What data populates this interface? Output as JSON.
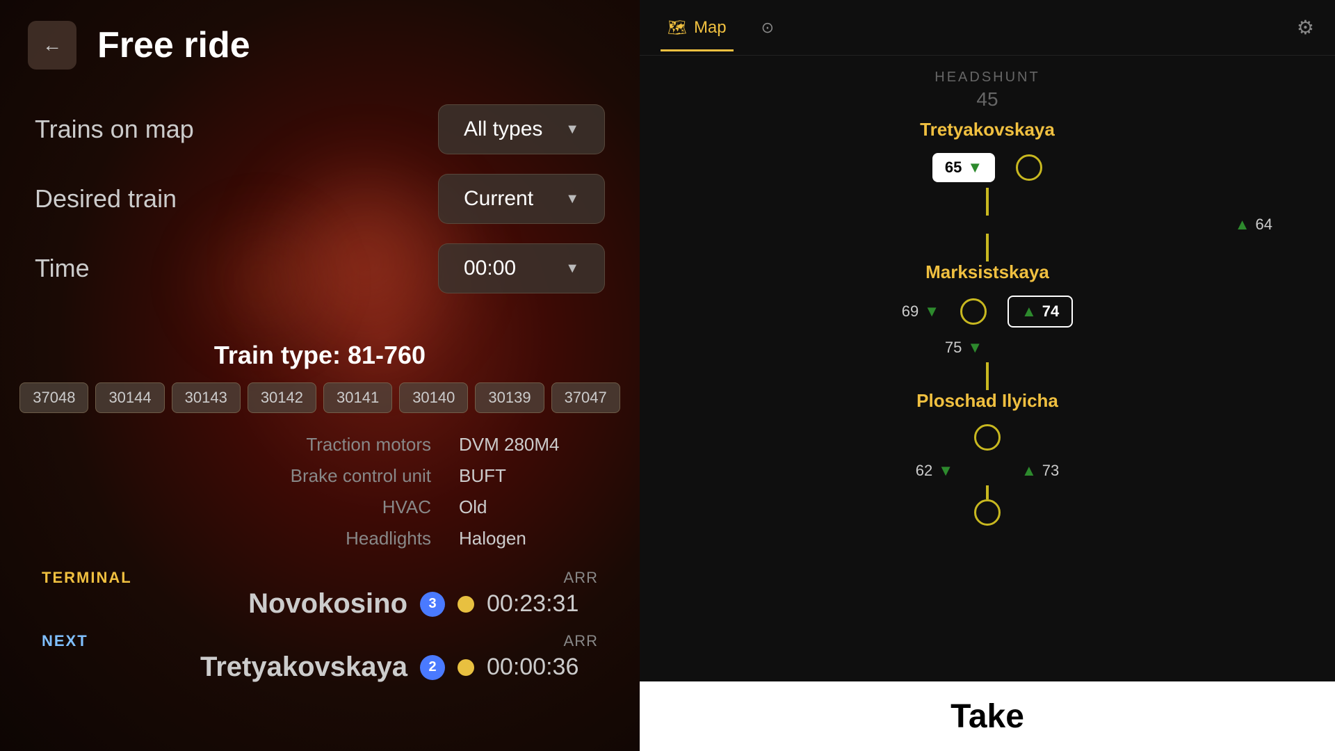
{
  "header": {
    "back_label": "←",
    "title": "Free ride"
  },
  "settings": {
    "trains_label": "Trains on map",
    "trains_value": "All types",
    "desired_label": "Desired train",
    "desired_value": "Current",
    "time_label": "Time",
    "time_value": "00:00"
  },
  "train_info": {
    "type_label": "Train type: 81-760",
    "badges": [
      "37048",
      "30144",
      "30143",
      "30142",
      "30141",
      "30140",
      "30139",
      "37047"
    ],
    "specs": [
      {
        "key": "Traction motors",
        "value": "DVM 280M4"
      },
      {
        "key": "Brake control unit",
        "value": "BUFT"
      },
      {
        "key": "HVAC",
        "value": "Old"
      },
      {
        "key": "Headlights",
        "value": "Halogen"
      }
    ]
  },
  "schedule": [
    {
      "type": "TERMINAL",
      "arr_label": "ARR",
      "station": "Novokosino",
      "line_num": "3",
      "time": "00:23:31"
    },
    {
      "type": "NEXT",
      "arr_label": "ARR",
      "station": "Tretyakovskaya",
      "line_num": "2",
      "time": "00:00:36"
    }
  ],
  "right_panel": {
    "nav": {
      "map_label": "Map",
      "search_icon": "🔍",
      "gear_icon": "⚙"
    },
    "map": {
      "headshunt_label": "HEADSHUNT",
      "headshunt_num": "45",
      "stations": [
        {
          "name": "Tretyakovskaya",
          "left_train": {
            "num": "65",
            "arrow": "▼"
          },
          "right_train": null
        },
        {
          "side_train_left": {
            "num": "64",
            "arrow": "▲"
          }
        },
        {
          "name": "Marksistskaya",
          "left_plain": {
            "num": "69",
            "arrow": "▼"
          },
          "right_badge_outline": {
            "num": "74",
            "arrow": "▲"
          },
          "left_badge_plain": {
            "num": "75",
            "arrow": "▼"
          }
        },
        {
          "name": "Ploschad Ilyicha",
          "left_train": {
            "num": "62",
            "arrow": "▼"
          },
          "right_train": {
            "num": "73",
            "arrow": "▲"
          }
        }
      ]
    },
    "take_button": "Take"
  }
}
